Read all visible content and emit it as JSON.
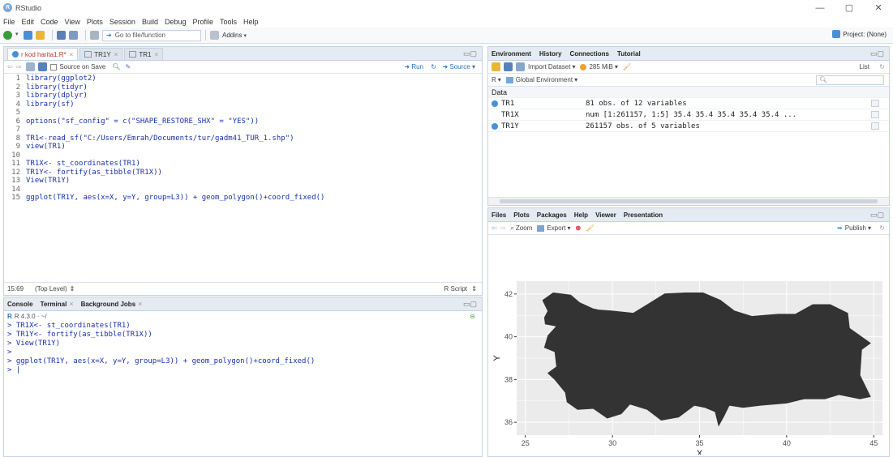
{
  "window": {
    "title": "RStudio",
    "minimize": "—",
    "maximize": "▢",
    "close": "✕"
  },
  "menu": [
    "File",
    "Edit",
    "Code",
    "View",
    "Plots",
    "Session",
    "Build",
    "Debug",
    "Profile",
    "Tools",
    "Help"
  ],
  "toolbar": {
    "goto_placeholder": "Go to file/function",
    "addins": "Addins",
    "project": "Project: (None)"
  },
  "editor": {
    "tabs": [
      {
        "label": "r kod harita1.R*",
        "active": true
      },
      {
        "label": "TR1Y",
        "active": false
      },
      {
        "label": "TR1",
        "active": false
      }
    ],
    "source_on_save": "Source on Save",
    "run": "Run",
    "source": "Source",
    "lines": [
      "library(ggplot2)",
      "library(tidyr)",
      "library(dplyr)",
      "library(sf)",
      "",
      "options(\"sf_config\" = c(\"SHAPE_RESTORE_SHX\" = \"YES\"))",
      "",
      "TR1<-read_sf(\"C:/Users/Emrah/Documents/tur/gadm41_TUR_1.shp\")",
      "view(TR1)",
      "",
      "TR1X<- st_coordinates(TR1)",
      "TR1Y<- fortify(as_tibble(TR1X))",
      "View(TR1Y)",
      "",
      "ggplot(TR1Y, aes(x=X, y=Y, group=L3)) + geom_polygon()+coord_fixed()"
    ],
    "cursor_pos": "15:69",
    "scope": "(Top Level)",
    "file_type": "R Script"
  },
  "console": {
    "tabs": [
      "Console",
      "Terminal",
      "Background Jobs"
    ],
    "r_version": "R 4.3.0 · ~/",
    "lines": [
      "> TR1X<- st_coordinates(TR1)",
      "> TR1Y<- fortify(as_tibble(TR1X))",
      "> View(TR1Y)",
      ">",
      "> ggplot(TR1Y, aes(x=X, y=Y, group=L3)) + geom_polygon()+coord_fixed()",
      "> |"
    ]
  },
  "environment": {
    "tabs": [
      "Environment",
      "History",
      "Connections",
      "Tutorial"
    ],
    "import_dataset": "Import Dataset",
    "memory": "285 MiB",
    "list_view": "List",
    "r_label": "R",
    "global_env": "Global Environment",
    "section": "Data",
    "rows": [
      {
        "name": "TR1",
        "value": "81 obs. of 12 variables",
        "icon": true
      },
      {
        "name": "TR1X",
        "value": "num [1:261157, 1:5] 35.4 35.4 35.4 35.4 35.4 ...",
        "icon": false
      },
      {
        "name": "TR1Y",
        "value": "261157 obs. of 5 variables",
        "icon": true
      }
    ]
  },
  "files": {
    "tabs": [
      "Files",
      "Plots",
      "Packages",
      "Help",
      "Viewer",
      "Presentation"
    ],
    "zoom": "Zoom",
    "export": "Export",
    "publish": "Publish"
  },
  "chart_data": {
    "type": "area",
    "xlabel": "X",
    "ylabel": "Y",
    "xlim": [
      24.5,
      45.5
    ],
    "ylim": [
      35.4,
      42.6
    ],
    "xticks": [
      25,
      30,
      35,
      40,
      45
    ],
    "yticks": [
      36,
      38,
      40,
      42
    ],
    "grid": true,
    "colors": {
      "panel": "#ebebeb",
      "fill": "#333333",
      "grid": "#ffffff"
    }
  }
}
